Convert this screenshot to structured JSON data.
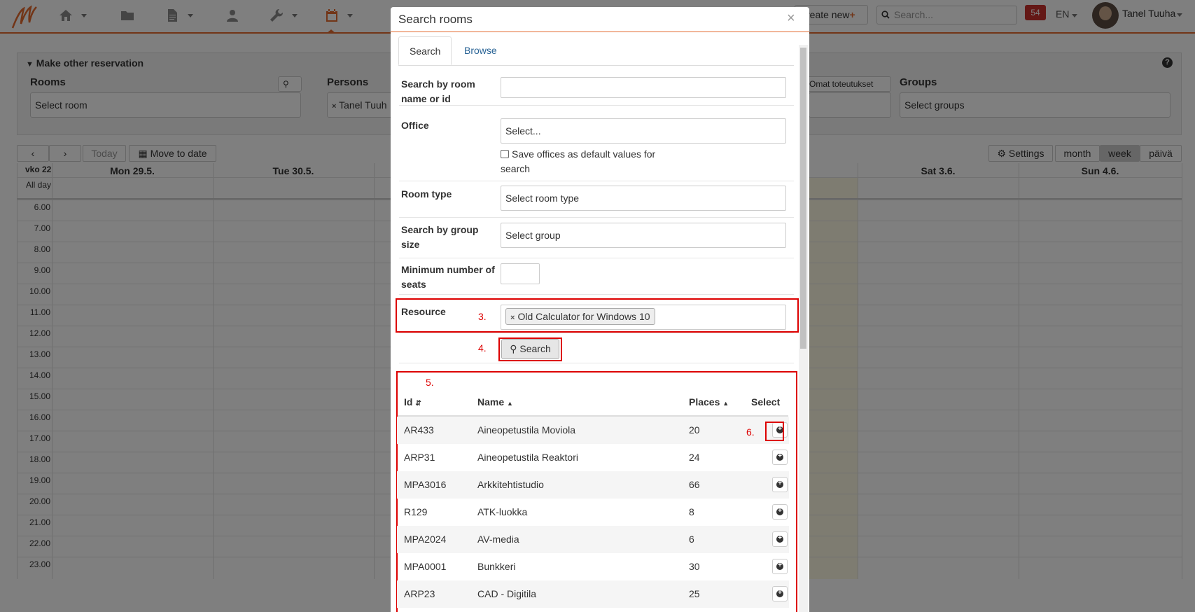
{
  "topbar": {
    "create_new": "reate new",
    "create_plus": "+",
    "search_placeholder": "Search...",
    "notif_count": "54",
    "lang": "EN",
    "username": "Tanel Tuuha"
  },
  "panel": {
    "title": "Make other reservation",
    "help": "?",
    "rooms_label": "Rooms",
    "rooms_placeholder": "Select room",
    "persons_label": "Persons",
    "persons_chip": "Tanel Tuuh",
    "own_implementations": "Omat toteutukset",
    "groups_label": "Groups",
    "groups_placeholder": "Select groups"
  },
  "calendar": {
    "today": "Today",
    "move_to_date": "Move to date",
    "settings": "Settings",
    "views": [
      "month",
      "week",
      "päivä"
    ],
    "week_label": "vko 22",
    "all_day": "All day",
    "days": [
      "Mon 29.5.",
      "Tue 30.5.",
      "Sat 3.6.",
      "Sun 4.6."
    ],
    "hours": [
      "6.00",
      "7.00",
      "8.00",
      "9.00",
      "10.00",
      "11.00",
      "12.00",
      "13.00",
      "14.00",
      "15.00",
      "16.00",
      "17.00",
      "18.00",
      "19.00",
      "20.00",
      "21.00",
      "22.00",
      "23.00"
    ]
  },
  "modal": {
    "title": "Search rooms",
    "close": "×",
    "tabs": [
      "Search",
      "Browse"
    ],
    "fields": {
      "search_by_name": "Search by room name or id",
      "office": "Office",
      "office_placeholder": "Select...",
      "save_offices": "Save offices as default values for search",
      "room_type": "Room type",
      "room_type_placeholder": "Select room type",
      "group_size": "Search by group size",
      "group_placeholder": "Select group",
      "min_seats": "Minimum number of seats",
      "resource": "Resource",
      "resource_chip": "Old Calculator for Windows 10"
    },
    "search_button": "Search",
    "steps": [
      "3.",
      "4.",
      "5.",
      "6."
    ],
    "table": {
      "headers": [
        "Id",
        "Name",
        "Places",
        "Select"
      ],
      "rows": [
        [
          "AR433",
          "Aineopetustila Moviola",
          "20"
        ],
        [
          "ARP31",
          "Aineopetustila Reaktori",
          "24"
        ],
        [
          "MPA3016",
          "Arkkitehtistudio",
          "66"
        ],
        [
          "R129",
          "ATK-luokka",
          "8"
        ],
        [
          "MPA2024",
          "AV-media",
          "6"
        ],
        [
          "MPA0001",
          "Bunkkeri",
          "30"
        ],
        [
          "ARP23",
          "CAD - Digitila",
          "25"
        ]
      ]
    }
  }
}
